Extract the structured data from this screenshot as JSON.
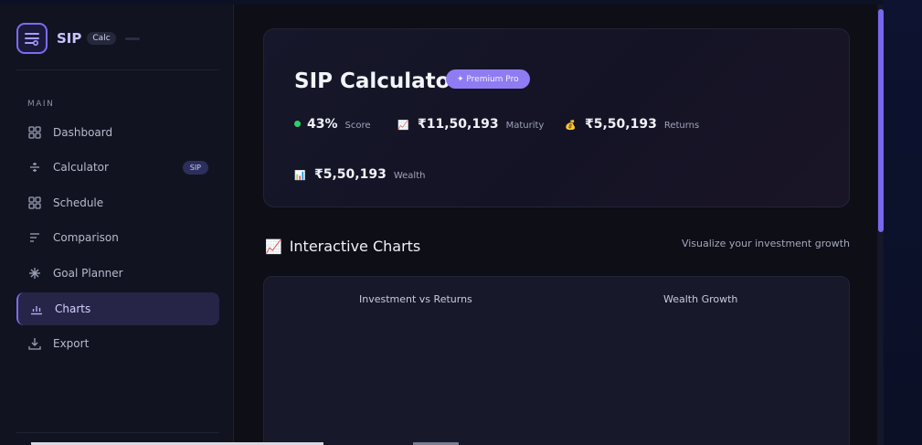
{
  "brand": {
    "name": "SIP",
    "tag": "Calc"
  },
  "sidebar": {
    "section_label": "MAIN",
    "items": [
      {
        "label": "Dashboard",
        "icon": "grid-icon"
      },
      {
        "label": "Calculator",
        "icon": "calculator-icon",
        "badge": "SIP"
      },
      {
        "label": "Schedule",
        "icon": "grid-icon"
      },
      {
        "label": "Comparison",
        "icon": "lines-icon"
      },
      {
        "label": "Goal Planner",
        "icon": "sparkle-icon"
      },
      {
        "label": "Charts",
        "icon": "bar-chart-icon",
        "active": true
      },
      {
        "label": "Export",
        "icon": "download-icon"
      }
    ]
  },
  "hero": {
    "title": "SIP Calculator",
    "badge": "✦ Premium Pro",
    "stats": [
      {
        "value": "43%",
        "label": "Score",
        "icon": "green-dot"
      },
      {
        "value": "₹11,50,193",
        "label": "Maturity",
        "icon": "chart-up-emoji"
      },
      {
        "value": "₹5,50,193",
        "label": "Returns",
        "icon": "money-bag-emoji"
      },
      {
        "value": "₹5,50,193",
        "label": "Wealth",
        "icon": "bar-chart-emoji"
      }
    ]
  },
  "charts_section": {
    "icon": "📈",
    "title": "Interactive Charts",
    "subtitle": "Visualize your investment growth",
    "chart_titles": [
      "Investment vs Returns",
      "Wealth Growth"
    ]
  },
  "colors": {
    "accent": "#7b6cf0",
    "badge": "#8f7cf3",
    "score_dot": "#2fcf6a",
    "background": "#0d0e16"
  }
}
